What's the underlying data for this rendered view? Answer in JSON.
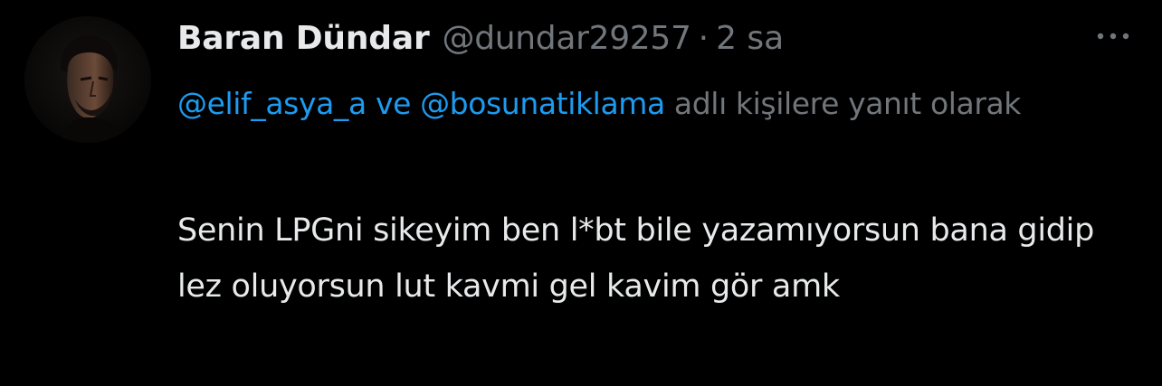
{
  "author": {
    "display_name": "Baran Dündar",
    "handle": "@dundar29257",
    "separator": "·",
    "time": "2 sa",
    "avatar_icon": "profile-photo"
  },
  "more_icon": "more-horizontal-icon",
  "reply_context": {
    "mention_1": "@elif_asya_a",
    "connector": " ve ",
    "mention_2": "@bosunatiklama",
    "suffix": " adlı kişilere yanıt olarak"
  },
  "tweet": {
    "text": "Senin LPGni sikeyim ben l*bt bile yazamıyorsun bana gidip lez oluyorsun lut kavmi gel kavim gör amk"
  },
  "colors": {
    "background": "#000000",
    "primary_text": "#e7e9ea",
    "secondary_text": "#71767b",
    "link": "#1d9bf0"
  }
}
